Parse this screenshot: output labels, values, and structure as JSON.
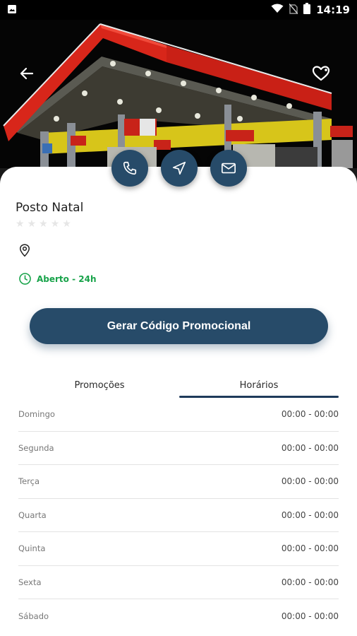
{
  "status_bar": {
    "time": "14:19",
    "icons": [
      "image-icon",
      "wifi-icon",
      "no-sim-icon",
      "battery-icon"
    ]
  },
  "hero": {
    "back_icon": "arrow-left-icon",
    "favorite_icon": "heart-icon"
  },
  "actions": {
    "icons": [
      "phone-icon",
      "navigation-icon",
      "mail-icon"
    ],
    "color": "#274b69"
  },
  "station": {
    "name": "Posto Natal",
    "rating": 0,
    "rating_max": 5,
    "address": "",
    "hours": "Aberto - 24h"
  },
  "promo_button": {
    "label": "Gerar Código Promocional"
  },
  "tabs": [
    {
      "label": "Promoções",
      "active": false
    },
    {
      "label": "Horários",
      "active": true
    }
  ],
  "schedule": [
    {
      "day": "Domingo",
      "range": "00:00 - 00:00"
    },
    {
      "day": "Segunda",
      "range": "00:00 - 00:00"
    },
    {
      "day": "Terça",
      "range": "00:00 - 00:00"
    },
    {
      "day": "Quarta",
      "range": "00:00 - 00:00"
    },
    {
      "day": "Quinta",
      "range": "00:00 - 00:00"
    },
    {
      "day": "Sexta",
      "range": "00:00 - 00:00"
    },
    {
      "day": "Sábado",
      "range": "00:00 - 00:00"
    }
  ],
  "colors": {
    "primary": "#274b69",
    "open_green": "#18a34a"
  }
}
